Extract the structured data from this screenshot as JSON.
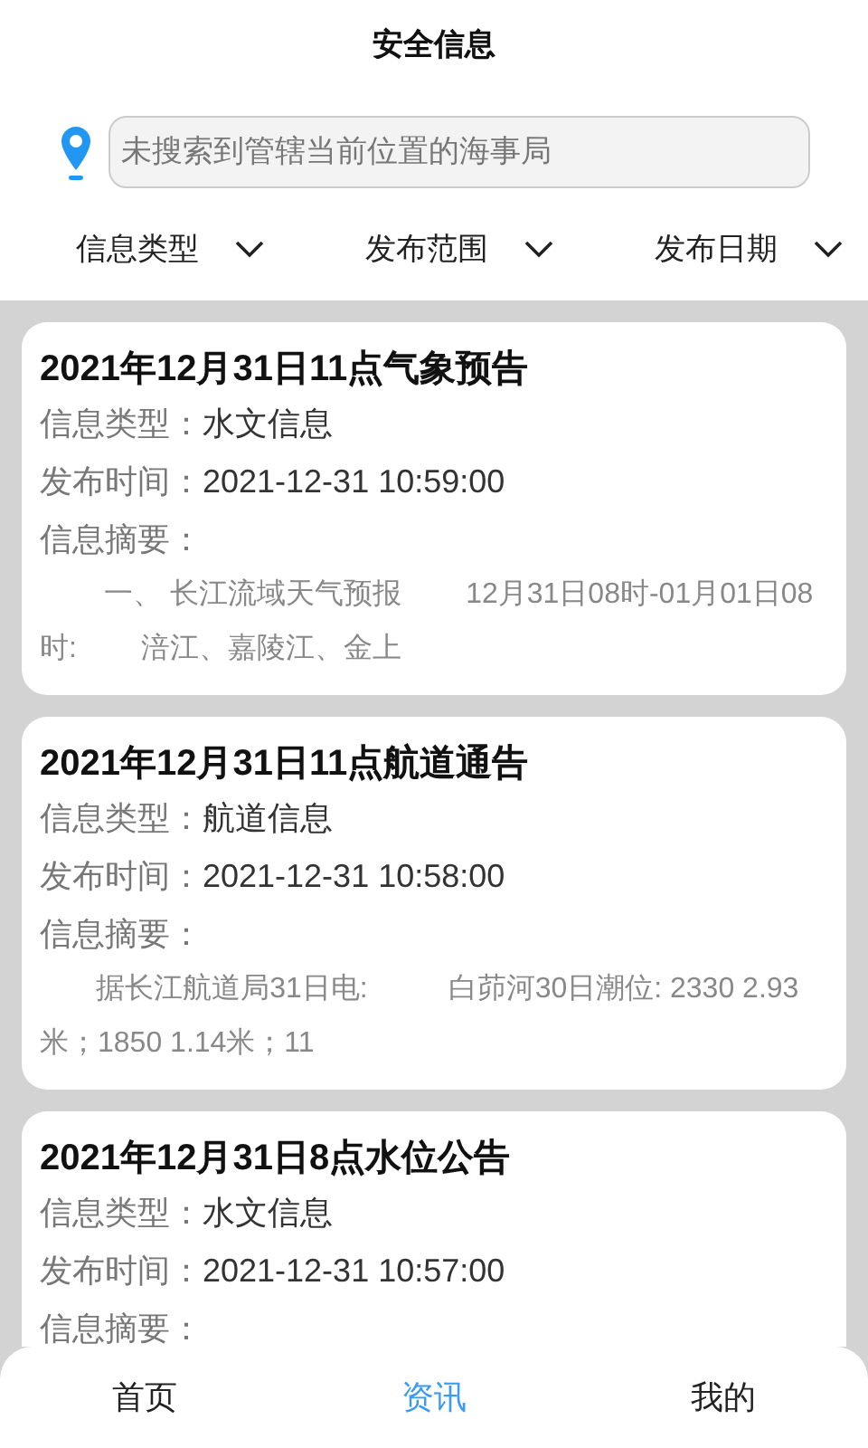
{
  "header": {
    "title": "安全信息"
  },
  "search": {
    "placeholder": "未搜索到管辖当前位置的海事局"
  },
  "filters": [
    {
      "label": "信息类型"
    },
    {
      "label": "发布范围"
    },
    {
      "label": "发布日期"
    }
  ],
  "cards": [
    {
      "title": "2021年12月31日11点气象预告",
      "type_label": "信息类型：",
      "type": "水文信息",
      "time_label": "发布时间：",
      "time": "2021-12-31 10:59:00",
      "summary_label": "信息摘要：",
      "summary": "        一、 长江流域天气预报        12月31日08时-01月01日08时:        涪江、嘉陵江、金上"
    },
    {
      "title": "2021年12月31日11点航道通告",
      "type_label": "信息类型：",
      "type": "航道信息",
      "time_label": "发布时间：",
      "time": "2021-12-31 10:58:00",
      "summary_label": "信息摘要：",
      "summary": "       据长江航道局31日电:          白茆河30日潮位: 2330 2.93米；1850 1.14米；11"
    },
    {
      "title": "2021年12月31日8点水位公告",
      "type_label": "信息类型：",
      "type": "水文信息",
      "time_label": "发布时间：",
      "time": "2021-12-31 10:57:00",
      "summary_label": "信息摘要："
    }
  ],
  "tabs": [
    {
      "label": "首页",
      "selected": false
    },
    {
      "label": "资讯",
      "selected": true
    },
    {
      "label": "我的",
      "selected": false
    }
  ]
}
